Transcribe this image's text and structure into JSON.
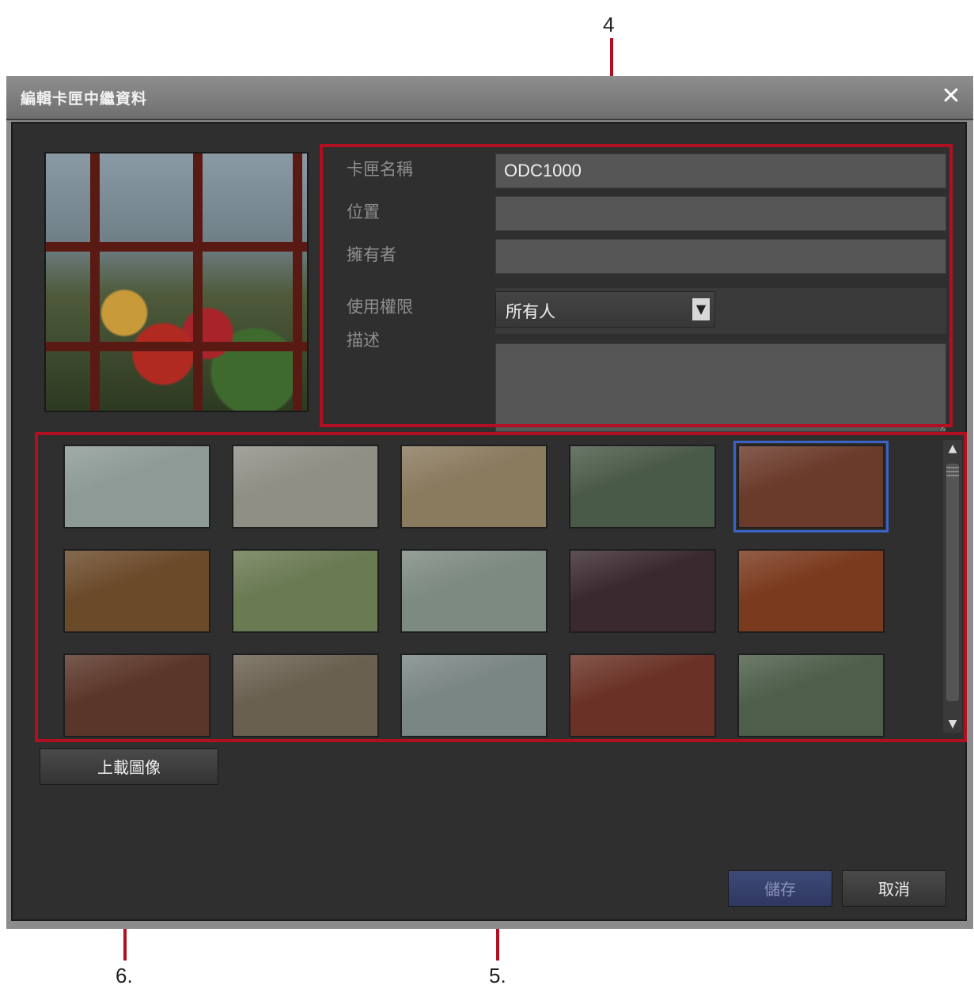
{
  "dialog": {
    "title": "編輯卡匣中繼資料",
    "close_symbol": "✕"
  },
  "form": {
    "fields": [
      {
        "label": "卡匣名稱",
        "value": "ODC1000"
      },
      {
        "label": "位置",
        "value": ""
      },
      {
        "label": "擁有者",
        "value": ""
      }
    ],
    "access": {
      "label": "使用權限",
      "value": "所有人",
      "arrow": "▼"
    },
    "description": {
      "label": "描述",
      "value": ""
    }
  },
  "thumbnails": {
    "count": 15,
    "selected_index": 4,
    "colors": [
      "#8d9a95",
      "#8f8f86",
      "#8a7a5e",
      "#4a5a48",
      "#6a3a2a",
      "#6b4a2a",
      "#6a7a52",
      "#7d8a80",
      "#3a2a30",
      "#7a3a1e",
      "#5a3628",
      "#6a6050",
      "#7a8684",
      "#6a3226",
      "#4e5e4a"
    ]
  },
  "scrollbar": {
    "up": "▲",
    "down": "▼"
  },
  "buttons": {
    "update_image": "上載圖像",
    "save": "儲存",
    "cancel": "取消"
  },
  "callouts": {
    "c4": "4",
    "c5": "5.",
    "c6": "6."
  }
}
